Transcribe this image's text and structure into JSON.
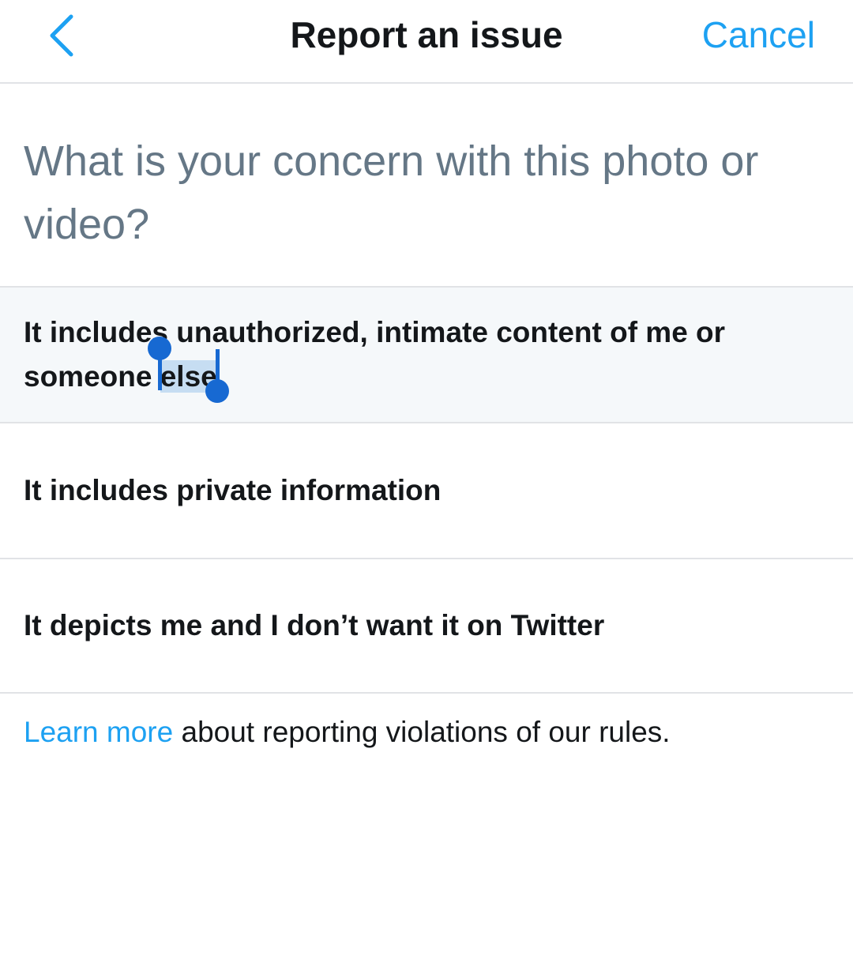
{
  "header": {
    "title": "Report an issue",
    "cancel_label": "Cancel",
    "back_icon": "chevron-left-icon"
  },
  "question": "What is your concern with this photo or video?",
  "options": [
    {
      "label_before": "It includes unauthorized, intimate content of me or someone ",
      "label_selected": "else",
      "selected": true
    },
    {
      "label": "It includes private information"
    },
    {
      "label": "It depicts me and I don’t want it on Twitter"
    }
  ],
  "footer": {
    "link_label": "Learn more",
    "text": " about reporting violations of our rules."
  },
  "colors": {
    "accent": "#1da1f2",
    "text_primary": "#14171a",
    "text_secondary": "#657786",
    "selection_handle": "#1769d2",
    "selection_highlight": "#c6ddf2",
    "selected_row_bg": "#f5f8fa"
  }
}
